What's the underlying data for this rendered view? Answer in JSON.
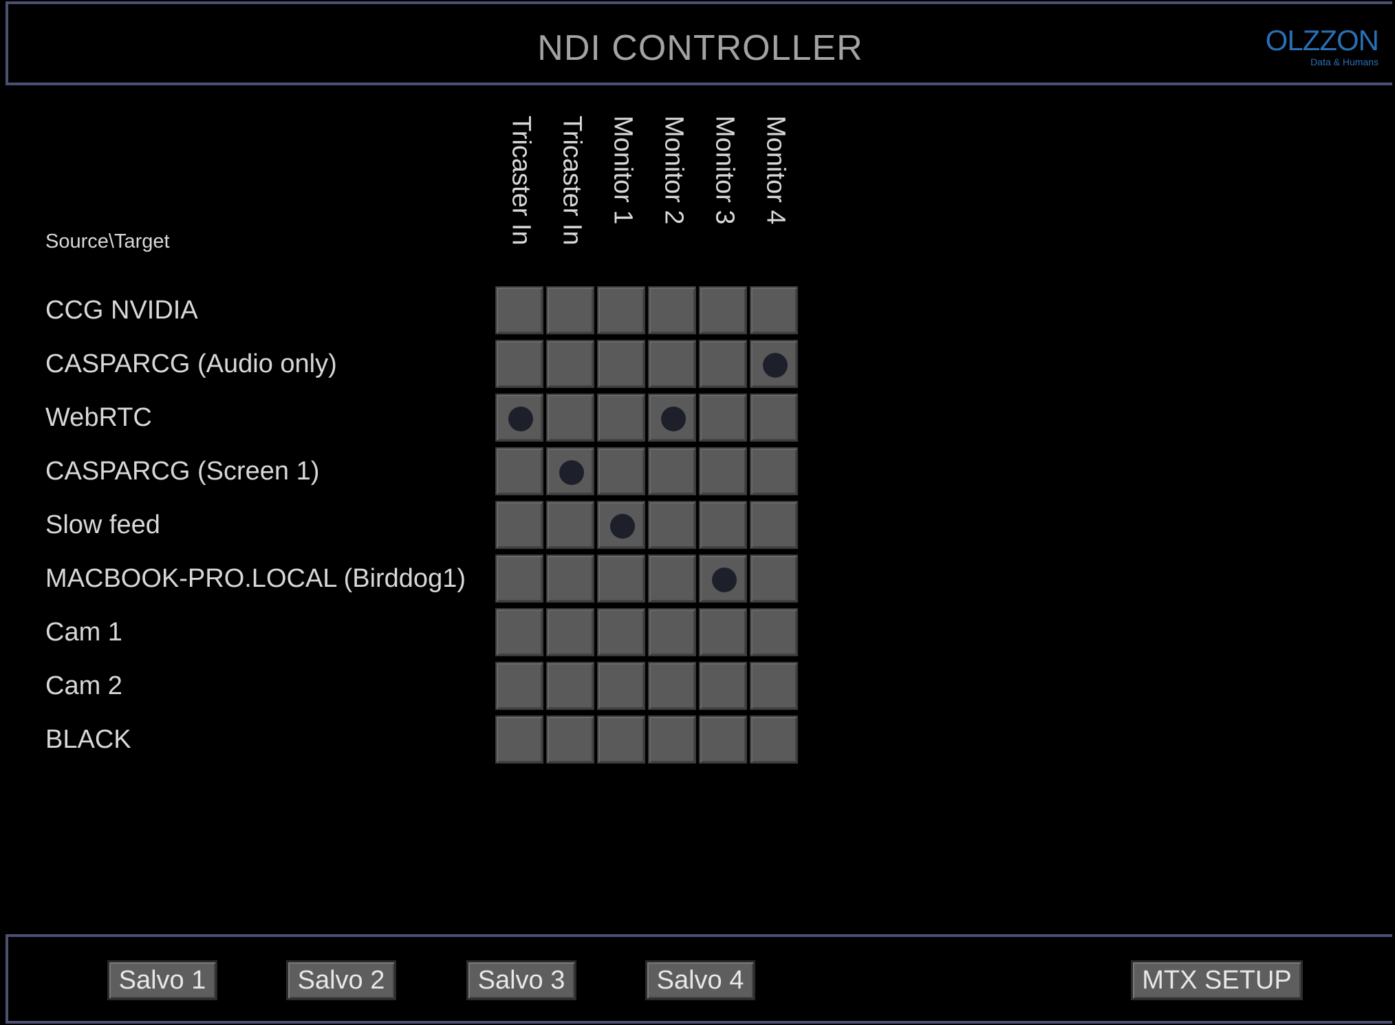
{
  "header": {
    "title": "NDI CONTROLLER",
    "logo": {
      "name": "OLZZON",
      "tagline": "Data & Humans"
    }
  },
  "matrix": {
    "corner_label": "Source\\Target",
    "targets": [
      "Tricaster In",
      "Tricaster In",
      "Monitor 1",
      "Monitor 2",
      "Monitor 3",
      "Monitor 4"
    ],
    "sources": [
      "CCG NVIDIA",
      "CASPARCG (Audio only)",
      "WebRTC",
      "CASPARCG (Screen 1)",
      "Slow feed",
      "MACBOOK-PRO.LOCAL (Birddog1)",
      "Cam 1",
      "Cam 2",
      "BLACK"
    ],
    "active_routes": [
      {
        "source": 1,
        "target": 5
      },
      {
        "source": 2,
        "target": 0
      },
      {
        "source": 2,
        "target": 3
      },
      {
        "source": 3,
        "target": 1
      },
      {
        "source": 4,
        "target": 2
      },
      {
        "source": 5,
        "target": 4
      }
    ]
  },
  "footer": {
    "buttons": [
      "Salvo 1",
      "Salvo 2",
      "Salvo 3",
      "Salvo 4"
    ],
    "setup_button": "MTX SETUP"
  },
  "colors": {
    "border": "#4d4f73",
    "cell": "#5a5a5a",
    "dot": "#1d1f2b",
    "logo": "#2a6fb6"
  }
}
